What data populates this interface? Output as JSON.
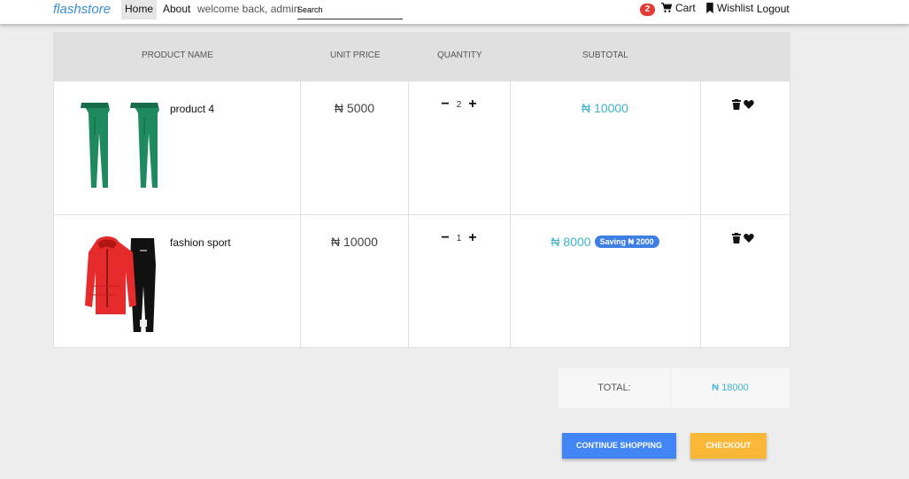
{
  "nav": {
    "brand": "flashstore",
    "home": "Home",
    "about": "About",
    "welcome": "welcome back, admin",
    "search_placeholder": "Search",
    "cart_count": "2",
    "cart": "Cart",
    "wishlist": "Wishlist",
    "logout": "Logout",
    "icons": {
      "cart": "cart-icon",
      "wishlist": "bookmark-icon"
    }
  },
  "table": {
    "headers": [
      "Product Name",
      "Unit Price",
      "Quantity",
      "Subtotal"
    ],
    "rows": [
      {
        "name": "product 4",
        "unit_price": "₦ 5000",
        "quantity": "2",
        "subtotal": "₦ 10000",
        "saving": ""
      },
      {
        "name": "fashion sport",
        "unit_price": "₦ 10000",
        "quantity": "1",
        "subtotal": "₦ 8000",
        "saving": "Saving ₦ 2000"
      }
    ],
    "qty_minus": "−",
    "qty_plus": "+"
  },
  "summary": {
    "total_label": "TOTAL:",
    "total_value": "₦ 18000"
  },
  "buttons": {
    "continue": "Continue Shopping",
    "checkout": "Checkout"
  },
  "colors": {
    "accent": "#3a8fd8",
    "price": "#3fb3cf",
    "badge": "#e53935",
    "continue": "#4285f4",
    "checkout": "#fbb737"
  }
}
